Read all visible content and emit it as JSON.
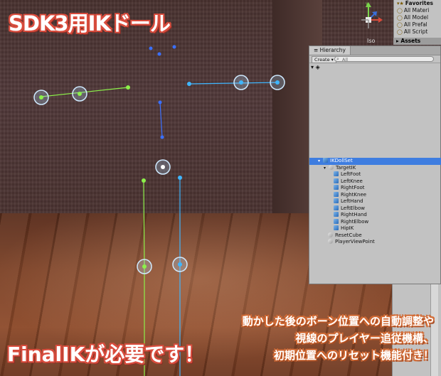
{
  "title": "SDK3用IKドール",
  "footer_left": "FinalIKが必要です！",
  "feature_lines": [
    "動かした後のボーン位置への自動調整や",
    "視線のプレイヤー追従機構、",
    "初期位置へのリセット機能付き！"
  ],
  "favorites": {
    "header": "Favorites",
    "items": [
      "All Materi",
      "All Model",
      "All Prefal",
      "All Script"
    ],
    "assets_label": "Assets"
  },
  "scene_view": {
    "projection_label": "Iso"
  },
  "hierarchy": {
    "tab_label": "Hierarchy",
    "create_label": "Create",
    "search_placeholder": "All",
    "items": [
      {
        "label": "IKDollSet",
        "selected": true
      },
      {
        "label": "TargetIK"
      },
      {
        "label": "LeftFoot"
      },
      {
        "label": "LeftKnee"
      },
      {
        "label": "RightFoot"
      },
      {
        "label": "RightKnee"
      },
      {
        "label": "LeftHand"
      },
      {
        "label": "LeftElbow"
      },
      {
        "label": "RightHand"
      },
      {
        "label": "RightElbow"
      },
      {
        "label": "HipIK"
      },
      {
        "label": "ResetCube"
      },
      {
        "label": "PlayerViewPoint"
      }
    ]
  },
  "colors": {
    "title_outline": "#d84c3d",
    "selection": "#3e7de0",
    "handle_ring": "#9fd6ff",
    "line_green": "#8cf04a",
    "line_blue": "#3fb6ff"
  }
}
